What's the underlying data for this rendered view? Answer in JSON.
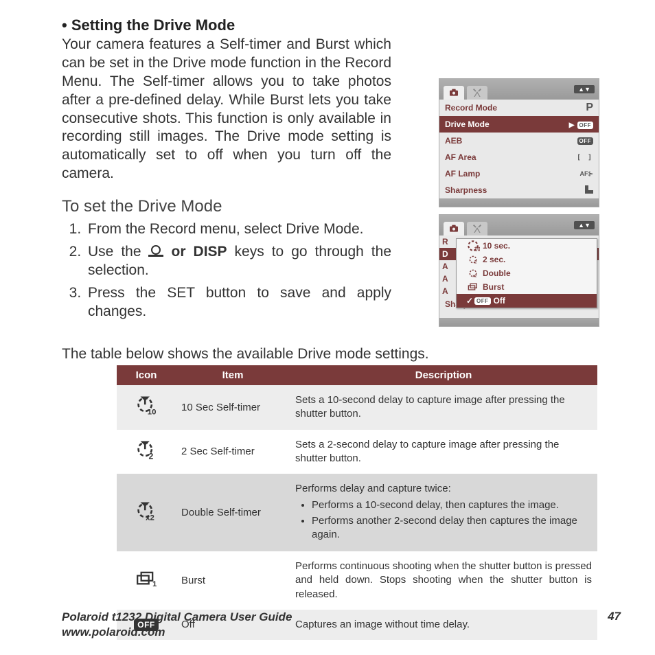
{
  "heading": "• Setting the Drive Mode",
  "intro": "Your camera features a Self-timer and Burst which can be set in the Drive mode function in the Record Menu. The Self-timer allows you to take photos after a pre-defined delay. While Burst lets you take consecutive shots. This function is only available in recording still images. The Drive mode setting is automatically set to off when you turn off the camera.",
  "subheading": "To set the Drive Mode",
  "steps": {
    "s1": "From the Record menu, select Drive Mode.",
    "s2a": "Use the ",
    "s2b": " or DISP",
    "s2c": " keys to go through the selection.",
    "s3": "Press the SET button to save and apply changes."
  },
  "table_intro": "The table below shows the available Drive mode settings.",
  "menu1": {
    "rows": [
      "Record Mode",
      "Drive Mode",
      "AEB",
      "AF Area",
      "AF Lamp",
      "Sharpness"
    ],
    "vals": {
      "off": "OFF",
      "p": "P",
      "af": "AF"
    }
  },
  "menu2": {
    "opts": [
      "10 sec.",
      "2 sec.",
      "Double",
      "Burst",
      "Off"
    ],
    "bottom": "Sharpness",
    "off": "OFF"
  },
  "table": {
    "headers": {
      "icon": "Icon",
      "item": "Item",
      "desc": "Description"
    },
    "rows": [
      {
        "item": "10 Sec Self-timer",
        "desc": "Sets a 10-second delay to capture image after pressing the shutter button.",
        "sub": "10"
      },
      {
        "item": "2 Sec Self-timer",
        "desc": "Sets a 2-second delay to capture image after pressing the shutter button.",
        "sub": "2"
      },
      {
        "item": "Double Self-timer",
        "desc_head": "Performs delay and capture twice:",
        "desc_b1": "Performs a 10-second delay, then captures the image.",
        "desc_b2": "Performs another 2-second delay then captures the image again.",
        "sub": "x2"
      },
      {
        "item": "Burst",
        "desc": "Performs continuous shooting when the shutter button is pressed and held down. Stops shooting when the shutter button is released.",
        "sub": "1"
      },
      {
        "item": "Off",
        "desc": "Captures an image without time delay.",
        "badge": "OFF"
      }
    ]
  },
  "footer": {
    "title": "Polaroid t1232 Digital Camera User Guide",
    "url": "www.polaroid.com",
    "page": "47"
  }
}
